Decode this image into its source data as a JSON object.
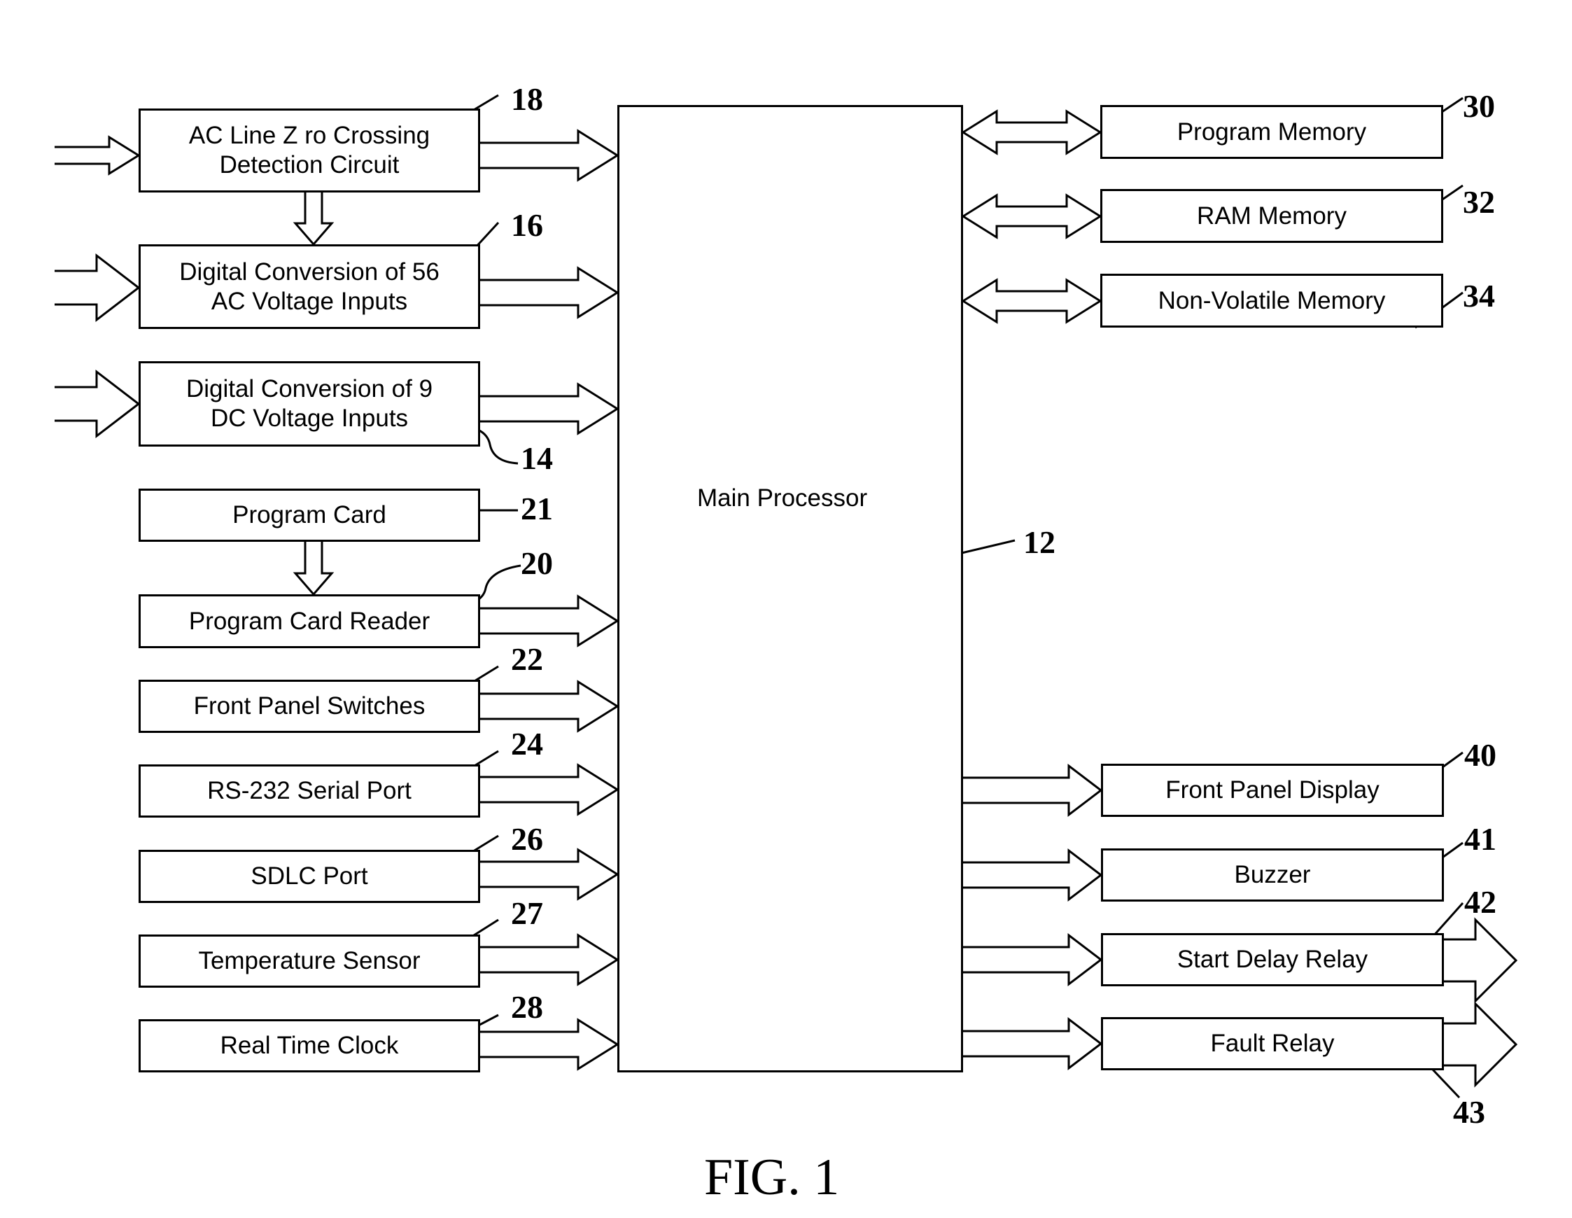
{
  "figure": {
    "caption": "FIG. 1",
    "main": {
      "label": "Main Processor",
      "ref": "12"
    },
    "inputs": [
      {
        "label": "AC Line Z  ro Crossing\nDetection Circuit",
        "ref": "18"
      },
      {
        "label": "Digital Conversion of 56\nAC Voltage Inputs",
        "ref": "16"
      },
      {
        "label": "Digital Conversion of 9\nDC Voltage Inputs",
        "ref": "14"
      },
      {
        "label": "Program Card",
        "ref": "21"
      },
      {
        "label": "Program Card Reader",
        "ref": "20"
      },
      {
        "label": "Front Panel Switches",
        "ref": "22"
      },
      {
        "label": "RS-232 Serial Port",
        "ref": "24"
      },
      {
        "label": "SDLC Port",
        "ref": "26"
      },
      {
        "label": "Temperature Sensor",
        "ref": "27"
      },
      {
        "label": "Real Time Clock",
        "ref": "28"
      }
    ],
    "memories": [
      {
        "label": "Program Memory",
        "ref": "30"
      },
      {
        "label": "RAM Memory",
        "ref": "32"
      },
      {
        "label": "Non-Volatile Memory",
        "ref": "34"
      }
    ],
    "outputs": [
      {
        "label": "Front Panel Display",
        "ref": "40"
      },
      {
        "label": "Buzzer",
        "ref": "41"
      },
      {
        "label": "Start Delay Relay",
        "ref": "42"
      },
      {
        "label": "Fault Relay",
        "ref": "43"
      }
    ]
  }
}
